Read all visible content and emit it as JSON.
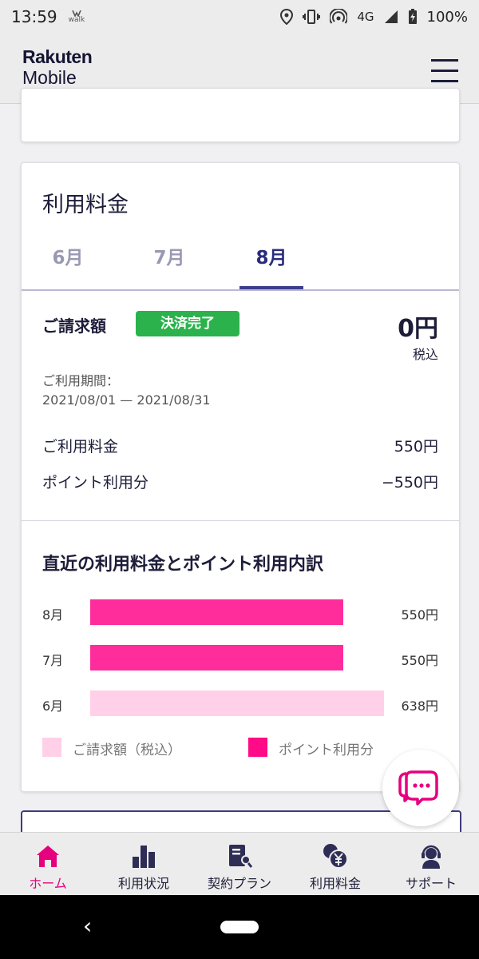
{
  "status_bar": {
    "time": "13:59",
    "walk_label": "walk",
    "network": "4G",
    "battery": "100%"
  },
  "header": {
    "logo_line1": "Rakuten",
    "logo_line2": "Mobile"
  },
  "usage_card": {
    "title": "利用料金",
    "tabs": [
      {
        "label": "6月"
      },
      {
        "label": "7月"
      },
      {
        "label": "8月"
      }
    ],
    "active_tab": "8月",
    "billing_label": "ご請求額",
    "status_badge": "決済完了",
    "amount": "0円",
    "tax_note": "税込",
    "period_label": "ご利用期間：",
    "period_value": "2021/08/01 — 2021/08/31",
    "usage_fee_label": "ご利用料金",
    "usage_fee_value": "550円",
    "points_label": "ポイント利用分",
    "points_value": "−550円"
  },
  "chart_data": {
    "type": "bar",
    "orientation": "horizontal",
    "title": "直近の利用料金とポイント利用内訳",
    "categories": [
      "8月",
      "7月",
      "6月"
    ],
    "value_labels": [
      "550円",
      "550円",
      "638円"
    ],
    "series": [
      {
        "name": "ポイント利用分",
        "values": [
          550,
          550,
          0
        ],
        "color": "#ff2d9b"
      },
      {
        "name": "ご請求額（税込）",
        "values": [
          0,
          0,
          638
        ],
        "color": "#ffd0e8"
      }
    ],
    "legend": [
      {
        "label": "ご請求額（税込）",
        "color": "#ffd0e8"
      },
      {
        "label": "ポイント利用分",
        "color": "#ff0a87"
      }
    ],
    "legend_position": "bottom",
    "xlim": [
      0,
      638
    ]
  },
  "bottom_nav": {
    "items": [
      {
        "label": "ホーム",
        "icon": "home-icon"
      },
      {
        "label": "利用状況",
        "icon": "bar-chart-icon"
      },
      {
        "label": "契約プラン",
        "icon": "contract-icon"
      },
      {
        "label": "利用料金",
        "icon": "yen-coins-icon"
      },
      {
        "label": "サポート",
        "icon": "support-icon"
      }
    ],
    "active": "ホーム"
  },
  "colors": {
    "accent_pink": "#e6007e",
    "navy": "#1d1d3a",
    "badge_green": "#2bb24c"
  }
}
